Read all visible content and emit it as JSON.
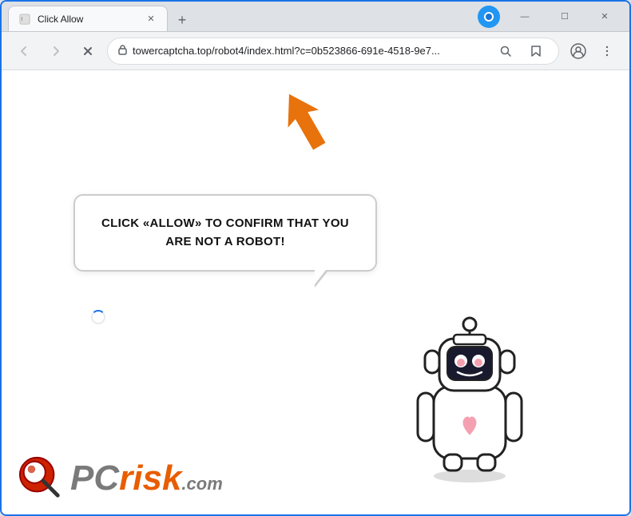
{
  "browser": {
    "tab": {
      "title": "Click Allow",
      "favicon_label": "warning-favicon"
    },
    "new_tab_label": "+",
    "window_controls": {
      "minimize": "—",
      "maximize": "☐",
      "close": "✕"
    },
    "toolbar": {
      "back_label": "←",
      "forward_label": "→",
      "reload_label": "✕",
      "url": "towercaptcha.top/robot4/index.html?c=0b523866-691e-4518-9e7...",
      "search_icon_label": "🔍",
      "bookmark_icon_label": "☆",
      "profile_icon_label": "👤",
      "menu_icon_label": "⋮"
    }
  },
  "page": {
    "bubble_text_line1": "CLICK «ALLOW» TO CONFIRM THAT YOU",
    "bubble_text_line2": "ARE NOT A ROBOT!",
    "arrow_label": "orange-arrow-pointing-up-left",
    "robot_label": "robot-illustration",
    "logo": {
      "pc_text": "PC",
      "risk_text": "risk",
      "dot_com": ".com"
    }
  },
  "colors": {
    "browser_border": "#1a73e8",
    "orange_arrow": "#e8720c",
    "tab_bg": "#f8f9fa",
    "toolbar_bg": "#f1f3f4",
    "page_bg": "#ffffff",
    "text_dark": "#111111",
    "pc_gray": "#7a7a7a",
    "risk_orange": "#e85d00"
  }
}
